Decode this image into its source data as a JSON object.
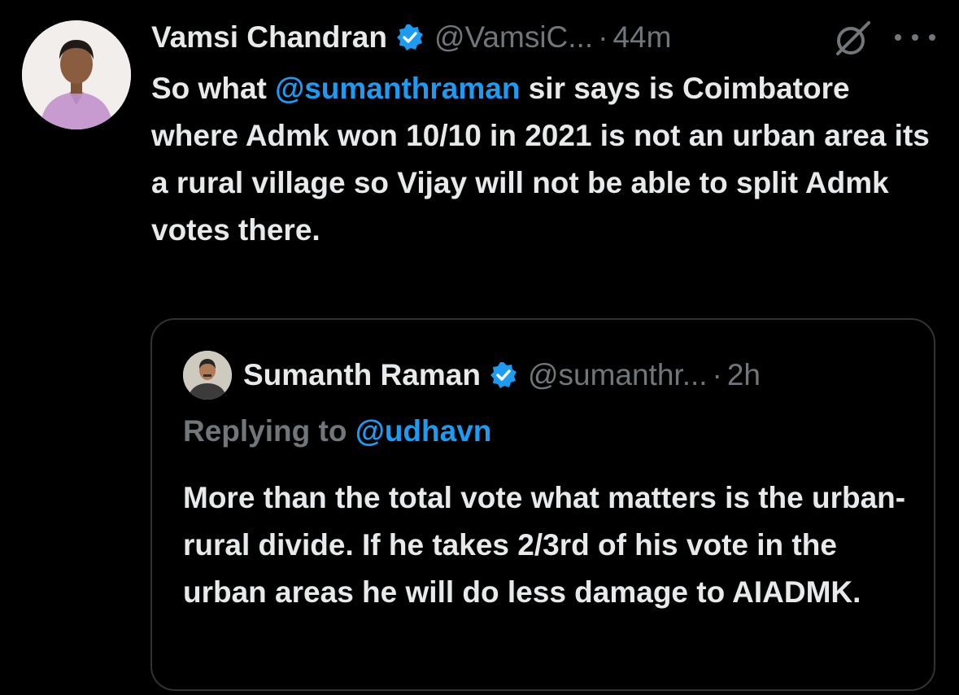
{
  "tweet": {
    "display_name": "Vamsi Chandran",
    "handle": "@VamsiC...",
    "separator": "·",
    "time": "44m",
    "text_before": "So what ",
    "mention": "@sumanthraman",
    "text_after": " sir says is Coimbatore where Admk won 10/10 in 2021 is not an urban area its a rural village so Vijay will not be able to split Admk votes there."
  },
  "quote": {
    "display_name": "Sumanth Raman",
    "handle": "@sumanthr...",
    "separator": "·",
    "time": "2h",
    "replying_label": "Replying to ",
    "replying_handle": "@udhavn",
    "text": "More than the total vote what matters is the urban-rural divide. If he takes 2/3rd of his vote in the urban areas he will do less damage to AIADMK."
  },
  "icons": {
    "verified": "verified-badge-icon",
    "grok": "grok-icon",
    "more": "more-options-icon"
  },
  "colors": {
    "background": "#000000",
    "text": "#e7e9ea",
    "secondary": "#71767b",
    "accent": "#1d9bf0",
    "border": "#2f3336"
  }
}
